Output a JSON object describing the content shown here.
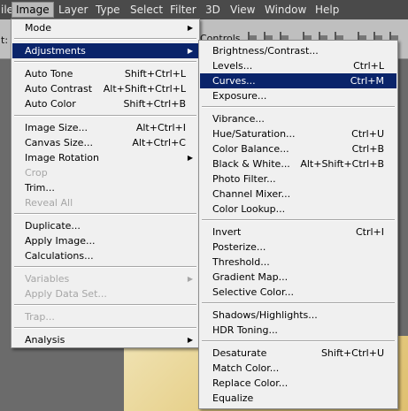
{
  "menubar": {
    "items": [
      {
        "label": "ile"
      },
      {
        "label": "Image"
      },
      {
        "label": "Layer"
      },
      {
        "label": "Type"
      },
      {
        "label": "Select"
      },
      {
        "label": "Filter"
      },
      {
        "label": "3D"
      },
      {
        "label": "View"
      },
      {
        "label": "Window"
      },
      {
        "label": "Help"
      }
    ],
    "active": "Image"
  },
  "options_bar": {
    "left_fragment": "t:",
    "controls_label": "Controls"
  },
  "image_menu": {
    "mode": {
      "label": "Mode"
    },
    "adjustments": {
      "label": "Adjustments"
    },
    "auto_tone": {
      "label": "Auto Tone",
      "shortcut": "Shift+Ctrl+L"
    },
    "auto_contrast": {
      "label": "Auto Contrast",
      "shortcut": "Alt+Shift+Ctrl+L"
    },
    "auto_color": {
      "label": "Auto Color",
      "shortcut": "Shift+Ctrl+B"
    },
    "image_size": {
      "label": "Image Size...",
      "shortcut": "Alt+Ctrl+I"
    },
    "canvas_size": {
      "label": "Canvas Size...",
      "shortcut": "Alt+Ctrl+C"
    },
    "image_rotation": {
      "label": "Image Rotation"
    },
    "crop": {
      "label": "Crop"
    },
    "trim": {
      "label": "Trim..."
    },
    "reveal_all": {
      "label": "Reveal All"
    },
    "duplicate": {
      "label": "Duplicate..."
    },
    "apply_image": {
      "label": "Apply Image..."
    },
    "calculations": {
      "label": "Calculations..."
    },
    "variables": {
      "label": "Variables"
    },
    "apply_data_set": {
      "label": "Apply Data Set..."
    },
    "trap": {
      "label": "Trap..."
    },
    "analysis": {
      "label": "Analysis"
    }
  },
  "adjustments_menu": {
    "brightness_contrast": {
      "label": "Brightness/Contrast..."
    },
    "levels": {
      "label": "Levels...",
      "shortcut": "Ctrl+L"
    },
    "curves": {
      "label": "Curves...",
      "shortcut": "Ctrl+M"
    },
    "exposure": {
      "label": "Exposure..."
    },
    "vibrance": {
      "label": "Vibrance..."
    },
    "hue_saturation": {
      "label": "Hue/Saturation...",
      "shortcut": "Ctrl+U"
    },
    "color_balance": {
      "label": "Color Balance...",
      "shortcut": "Ctrl+B"
    },
    "black_white": {
      "label": "Black & White...",
      "shortcut": "Alt+Shift+Ctrl+B"
    },
    "photo_filter": {
      "label": "Photo Filter..."
    },
    "channel_mixer": {
      "label": "Channel Mixer..."
    },
    "color_lookup": {
      "label": "Color Lookup..."
    },
    "invert": {
      "label": "Invert",
      "shortcut": "Ctrl+I"
    },
    "posterize": {
      "label": "Posterize..."
    },
    "threshold": {
      "label": "Threshold..."
    },
    "gradient_map": {
      "label": "Gradient Map..."
    },
    "selective_color": {
      "label": "Selective Color..."
    },
    "shadows_highlights": {
      "label": "Shadows/Highlights..."
    },
    "hdr_toning": {
      "label": "HDR Toning..."
    },
    "desaturate": {
      "label": "Desaturate",
      "shortcut": "Shift+Ctrl+U"
    },
    "match_color": {
      "label": "Match Color..."
    },
    "replace_color": {
      "label": "Replace Color..."
    },
    "equalize": {
      "label": "Equalize"
    }
  },
  "colors": {
    "menu_bg": "#f0f0f0",
    "highlight": "#0a246a",
    "disabled_text": "#a6a6a6",
    "menubar_bg": "#4a4a4a"
  },
  "icons": {
    "submenu_arrow": "triangle-right-icon",
    "align_icon": "align-icon"
  }
}
